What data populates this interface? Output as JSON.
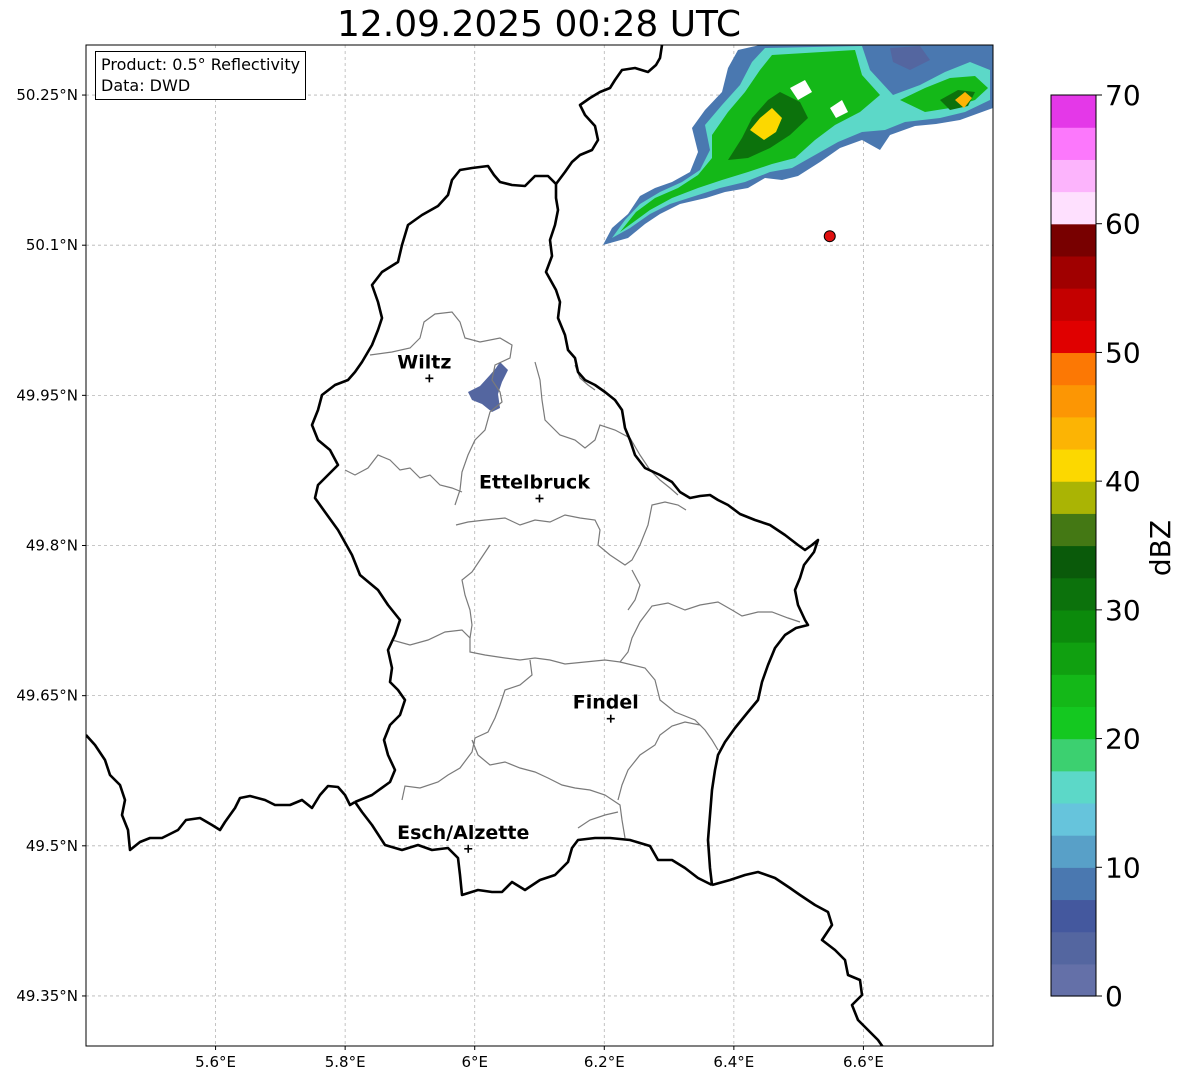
{
  "title": "12.09.2025 00:28 UTC",
  "info": {
    "product": "Product: 0.5° Reflectivity",
    "source": "Data: DWD"
  },
  "axes": {
    "lon_range": [
      5.4,
      6.8
    ],
    "lat_range": [
      49.3,
      50.3
    ],
    "x_ticks": [
      "5.6°E",
      "5.8°E",
      "6°E",
      "6.2°E",
      "6.4°E",
      "6.6°E"
    ],
    "y_ticks": [
      "50.25°N",
      "50.1°N",
      "49.95°N",
      "49.8°N",
      "49.65°N",
      "49.5°N",
      "49.35°N"
    ],
    "grid": true
  },
  "cities": [
    {
      "name": "Wiltz",
      "lon": 5.93,
      "lat": 49.967
    },
    {
      "name": "Ettelbruck",
      "lon": 6.1,
      "lat": 49.847
    },
    {
      "name": "Findel",
      "lon": 6.21,
      "lat": 49.627
    },
    {
      "name": "Esch/Alzette",
      "lon": 5.99,
      "lat": 49.497
    }
  ],
  "radar_site": {
    "lon": 6.548,
    "lat": 50.109,
    "color": "#e01010"
  },
  "colorbar": {
    "label": "dBZ",
    "ticks": [
      "0",
      "10",
      "20",
      "30",
      "40",
      "50",
      "60",
      "70"
    ],
    "range": [
      0,
      70
    ],
    "colors": [
      "#6470a8",
      "#5466a0",
      "#44589e",
      "#4a78b0",
      "#58a0c8",
      "#66c4dc",
      "#5cd8c8",
      "#3cd070",
      "#14c820",
      "#14b818",
      "#10a010",
      "#0c8a0c",
      "#0c720c",
      "#0a5a0a",
      "#447814",
      "#aab404",
      "#fcd800",
      "#fcb404",
      "#fc9604",
      "#fc7804",
      "#e00000",
      "#c40000",
      "#a00000",
      "#780000",
      "#fee0fe",
      "#fcb4fc",
      "#fc78fc",
      "#e438e8"
    ]
  }
}
